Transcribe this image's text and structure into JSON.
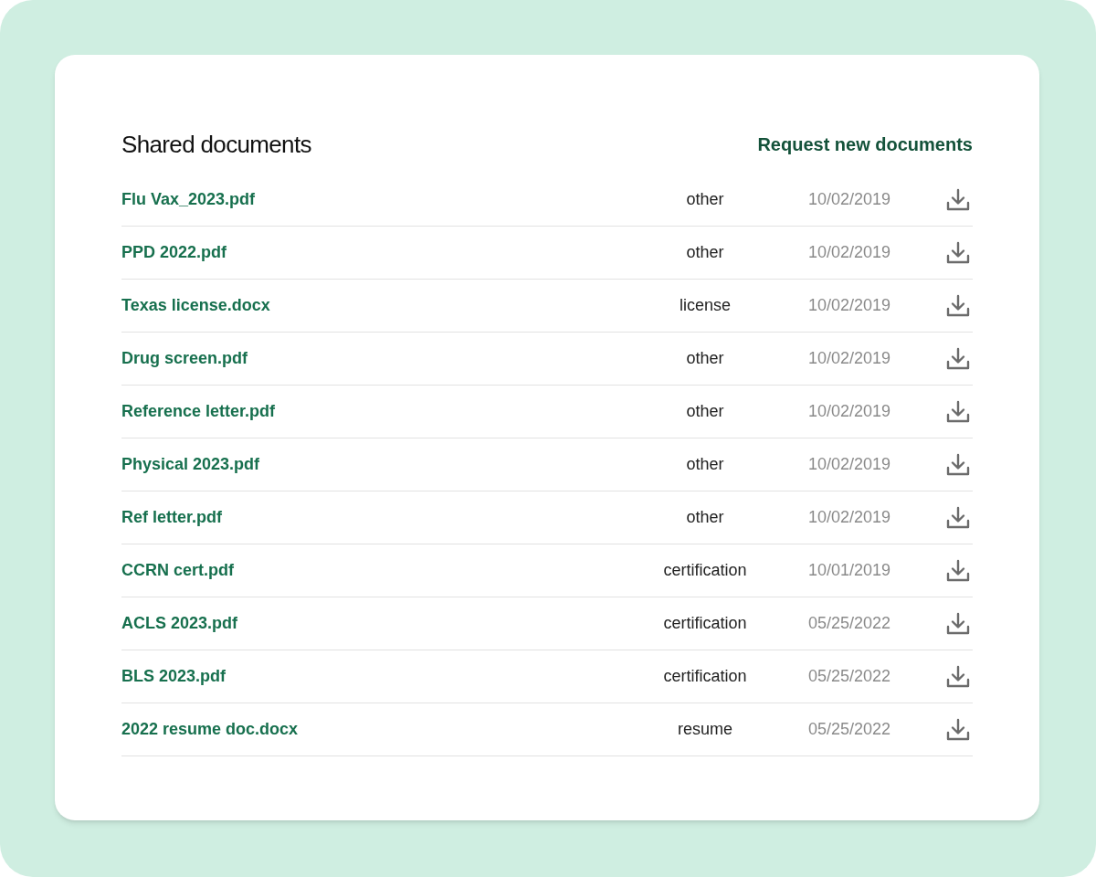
{
  "title": "Shared documents",
  "request_link": "Request new documents",
  "documents": [
    {
      "name": "Flu Vax_2023.pdf",
      "type": "other",
      "date": "10/02/2019"
    },
    {
      "name": "PPD 2022.pdf",
      "type": "other",
      "date": "10/02/2019"
    },
    {
      "name": "Texas license.docx",
      "type": "license",
      "date": "10/02/2019"
    },
    {
      "name": "Drug screen.pdf",
      "type": "other",
      "date": "10/02/2019"
    },
    {
      "name": "Reference letter.pdf",
      "type": "other",
      "date": "10/02/2019"
    },
    {
      "name": "Physical 2023.pdf",
      "type": "other",
      "date": "10/02/2019"
    },
    {
      "name": "Ref letter.pdf",
      "type": "other",
      "date": "10/02/2019"
    },
    {
      "name": "CCRN cert.pdf",
      "type": "certification",
      "date": "10/01/2019"
    },
    {
      "name": "ACLS 2023.pdf",
      "type": "certification",
      "date": "05/25/2022"
    },
    {
      "name": "BLS 2023.pdf",
      "type": "certification",
      "date": "05/25/2022"
    },
    {
      "name": "2022 resume doc.docx",
      "type": "resume",
      "date": "05/25/2022"
    }
  ]
}
